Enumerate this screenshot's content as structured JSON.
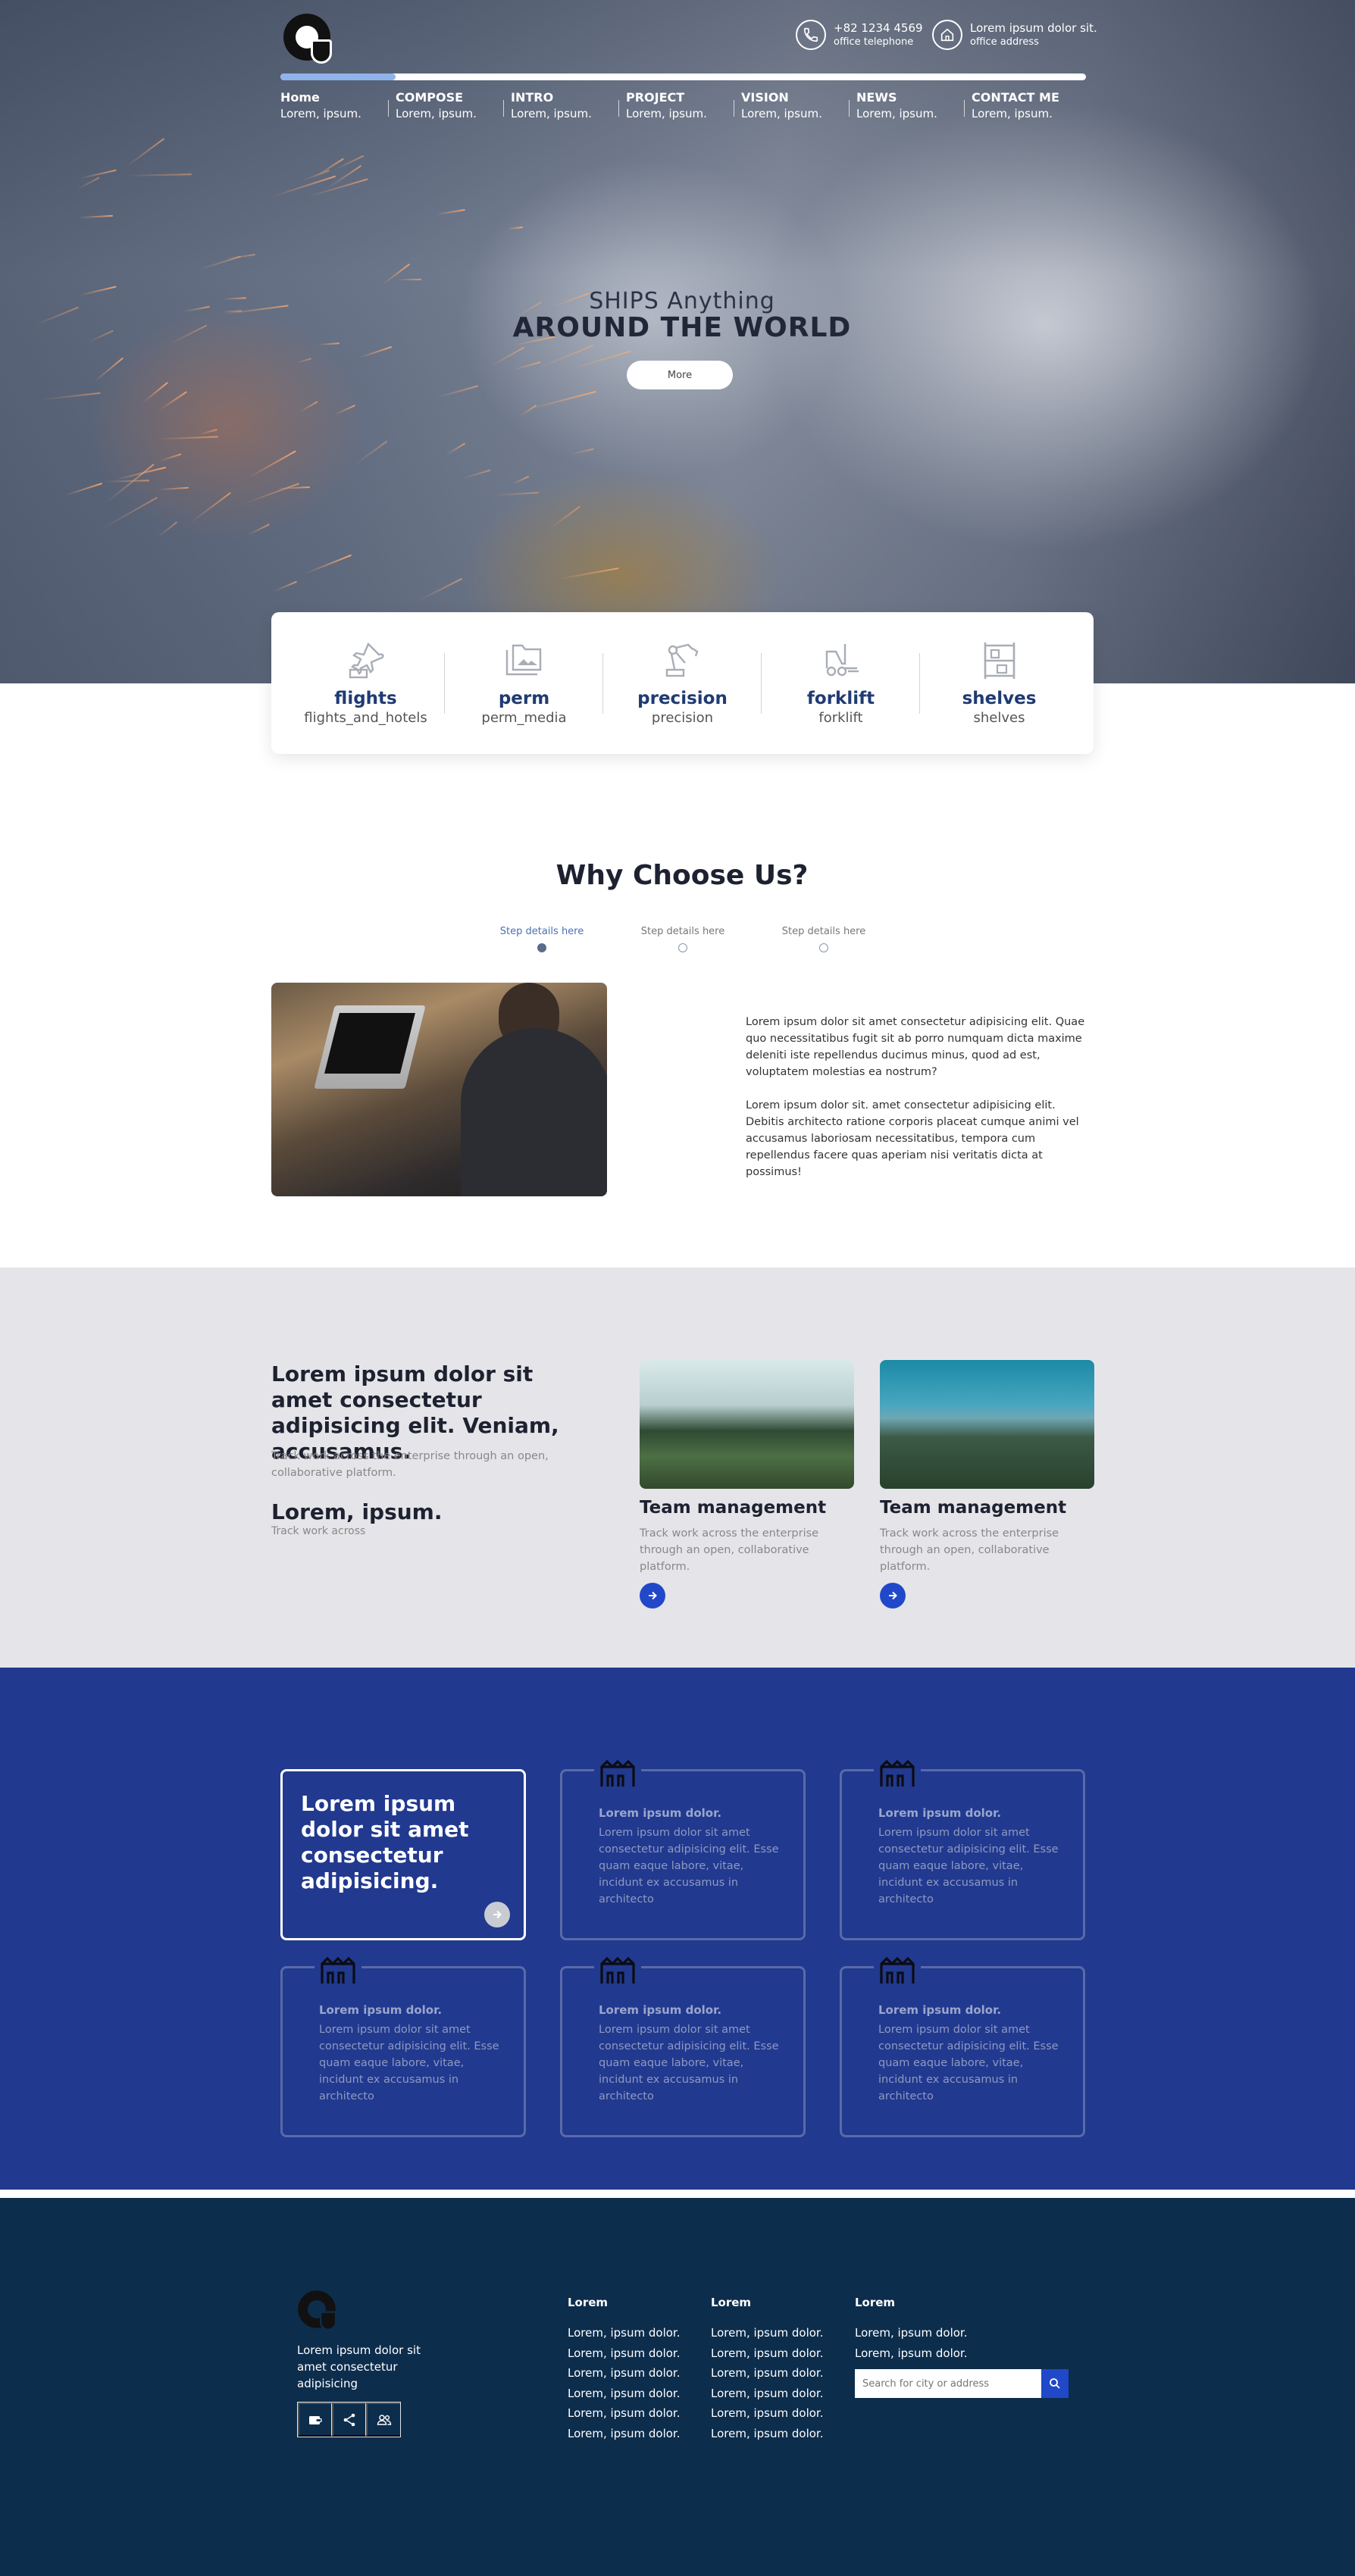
{
  "header": {
    "contacts": [
      {
        "line1": "+82 1234 4569",
        "line2": "office telephone",
        "icon": "phone-icon"
      },
      {
        "line1": "Lorem ipsum dolor sit.",
        "line2": "office address",
        "icon": "home-icon"
      }
    ],
    "nav_progress_fraction": 0.143,
    "nav": [
      {
        "title": "Home",
        "sub": "Lorem, ipsum."
      },
      {
        "title": "COMPOSE",
        "sub": "Lorem, ipsum."
      },
      {
        "title": "INTRO",
        "sub": "Lorem, ipsum."
      },
      {
        "title": "PROJECT",
        "sub": "Lorem, ipsum."
      },
      {
        "title": "VISION",
        "sub": "Lorem, ipsum."
      },
      {
        "title": "NEWS",
        "sub": "Lorem, ipsum."
      },
      {
        "title": "CONTACT ME",
        "sub": "Lorem, ipsum."
      }
    ]
  },
  "hero": {
    "subtitle": "SHIPS Anything",
    "title": "AROUND THE WORLD",
    "button": "More"
  },
  "services": [
    {
      "name": "flights",
      "sub": "flights_and_hotels",
      "icon": "flight-hotel-icon"
    },
    {
      "name": "perm",
      "sub": "perm_media",
      "icon": "perm-media-icon"
    },
    {
      "name": "precision",
      "sub": "precision",
      "icon": "precision-manufacturing-icon"
    },
    {
      "name": "forklift",
      "sub": "forklift",
      "icon": "forklift-icon"
    },
    {
      "name": "shelves",
      "sub": "shelves",
      "icon": "shelves-icon"
    }
  ],
  "why": {
    "title": "Why Choose Us?",
    "steps": [
      "Step details here",
      "Step details here",
      "Step details here"
    ],
    "active_step": 0,
    "paragraphs": [
      "Lorem ipsum dolor sit amet consectetur adipisicing elit. Quae quo necessitatibus fugit sit ab porro numquam dicta maxime deleniti iste repellendus ducimus minus, quod ad est, voluptatem molestias ea nostrum?",
      "Lorem ipsum dolor sit. amet consectetur adipisicing elit. Debitis architecto ratione corporis placeat cumque animi vel accusamus laboriosam necessitatibus, tempora cum repellendus facere quas aperiam nisi veritatis dicta at possimus!"
    ]
  },
  "team": {
    "title": "Lorem ipsum dolor sit amet consectetur adipisicing elit. Veniam, accusamus.",
    "desc": "Track work across the enterprise through an open, collaborative platform.",
    "heading2": "Lorem, ipsum.",
    "small": "Track work across",
    "cards": [
      {
        "title": "Team management",
        "text": "Track work across the enterprise through an open, collaborative platform."
      },
      {
        "title": "Team management",
        "text": "Track work across the enterprise through an open, collaborative platform."
      }
    ]
  },
  "features": {
    "featured": "Lorem ipsum dolor sit amet consectetur adipisicing.",
    "cards": [
      {
        "title": "Lorem ipsum dolor.",
        "text": "Lorem ipsum dolor sit amet consectetur adipisicing elit. Esse quam eaque labore, vitae, incidunt ex accusamus in architecto"
      },
      {
        "title": "Lorem ipsum dolor.",
        "text": "Lorem ipsum dolor sit amet consectetur adipisicing elit. Esse quam eaque labore, vitae, incidunt ex accusamus in architecto"
      },
      {
        "title": "Lorem ipsum dolor.",
        "text": "Lorem ipsum dolor sit amet consectetur adipisicing elit. Esse quam eaque labore, vitae, incidunt ex accusamus in architecto"
      },
      {
        "title": "Lorem ipsum dolor.",
        "text": "Lorem ipsum dolor sit amet consectetur adipisicing elit. Esse quam eaque labore, vitae, incidunt ex accusamus in architecto"
      },
      {
        "title": "Lorem ipsum dolor.",
        "text": "Lorem ipsum dolor sit amet consectetur adipisicing elit. Esse quam eaque labore, vitae, incidunt ex accusamus in architecto"
      }
    ]
  },
  "footer": {
    "desc": "Lorem ipsum dolor sit amet consectetur adipisicing",
    "social_icons": [
      "wallet-icon",
      "share-icon",
      "group-icon"
    ],
    "columns": [
      {
        "heading": "Lorem",
        "items": [
          "Lorem, ipsum dolor.",
          "Lorem, ipsum dolor.",
          "Lorem, ipsum dolor.",
          "Lorem, ipsum dolor.",
          "Lorem, ipsum dolor.",
          "Lorem, ipsum dolor."
        ]
      },
      {
        "heading": "Lorem",
        "items": [
          "Lorem, ipsum dolor.",
          "Lorem, ipsum dolor.",
          "Lorem, ipsum dolor.",
          "Lorem, ipsum dolor.",
          "Lorem, ipsum dolor.",
          "Lorem, ipsum dolor."
        ]
      },
      {
        "heading": "Lorem",
        "items": [
          "Lorem, ipsum dolor.",
          "Lorem, ipsum dolor."
        ]
      }
    ],
    "search_placeholder": "Search for city or address"
  },
  "colors": {
    "accent": "#2048c8",
    "navy": "#1f3b73",
    "blue_section": "#21398f",
    "footer_bg": "#0d2d4c",
    "gray_bg": "#e5e5e9",
    "nav_progress": "#8fb3ea"
  }
}
